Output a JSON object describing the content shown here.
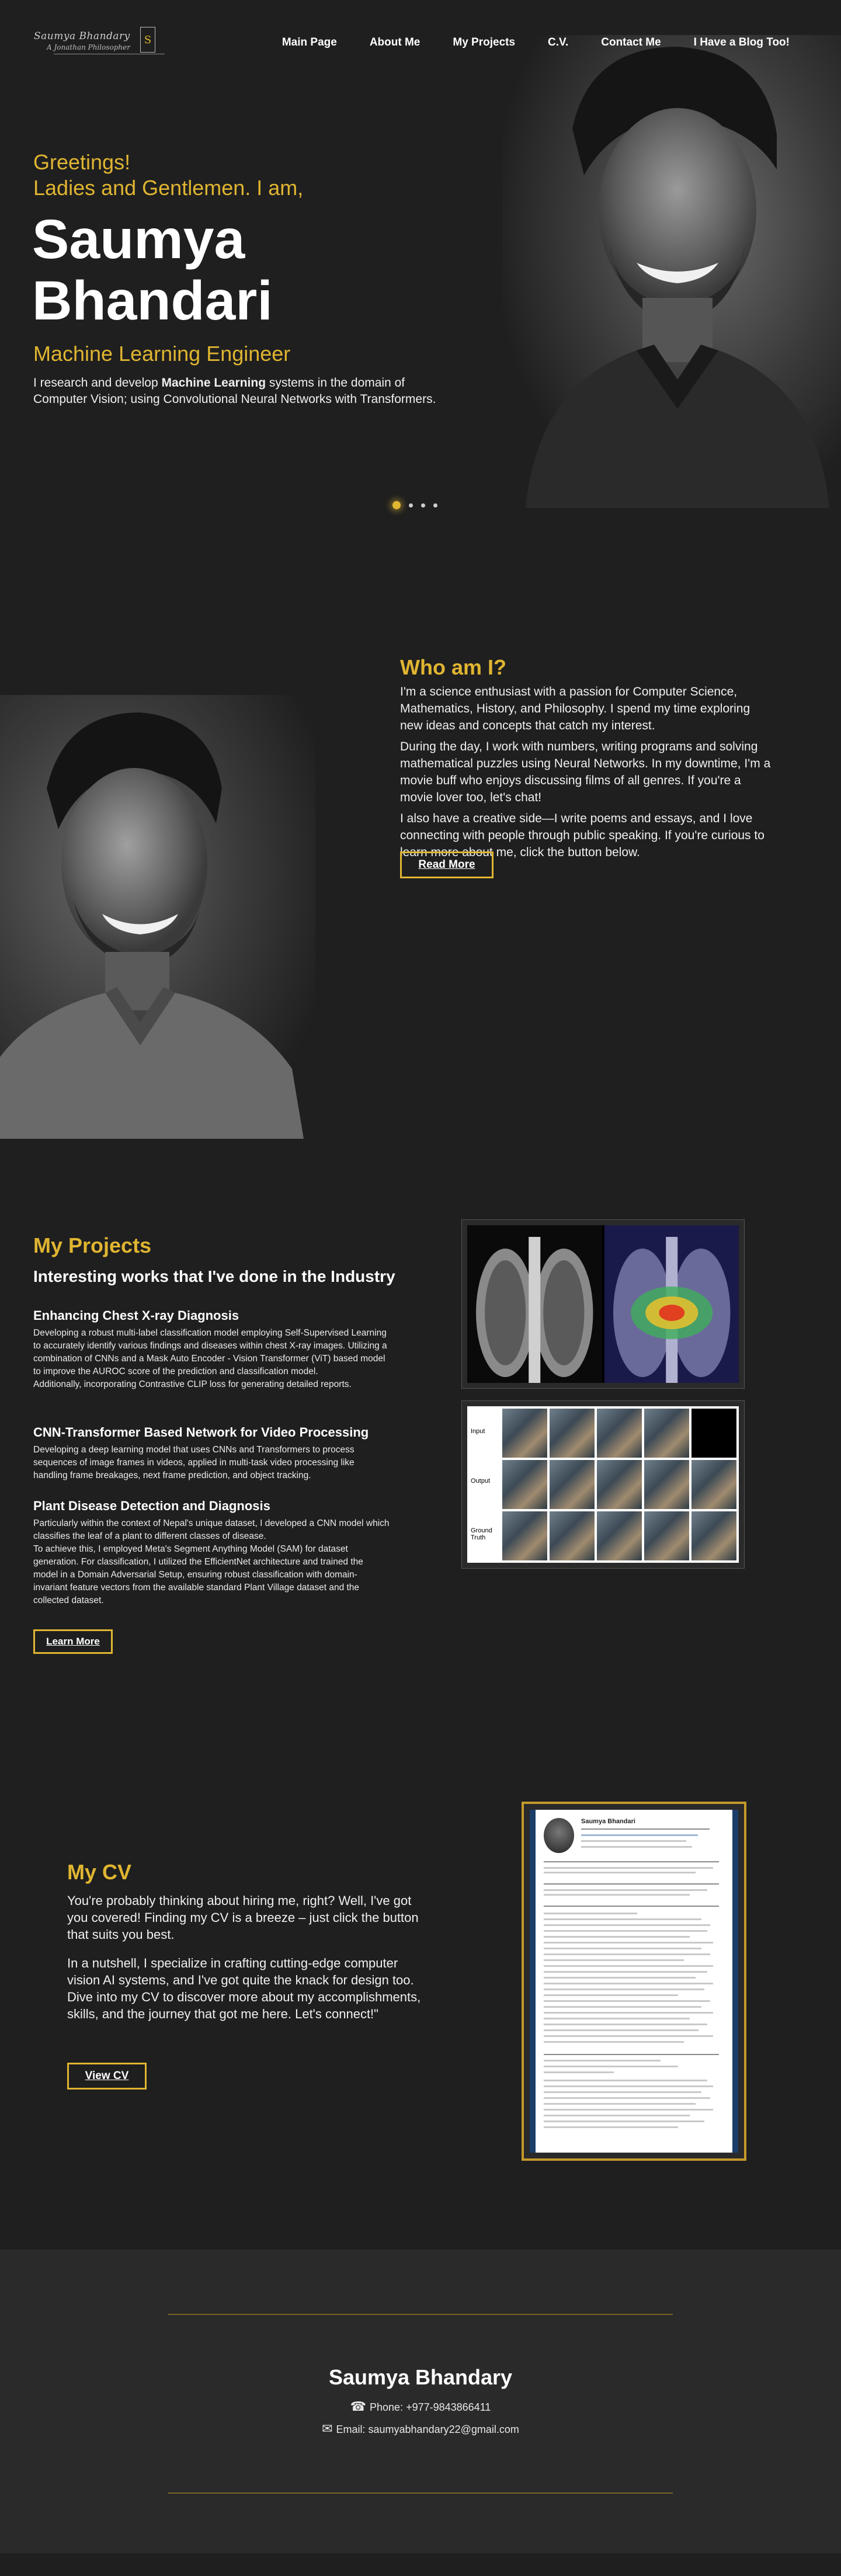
{
  "logo": {
    "name": "Saumya Bhandary",
    "tagline": "A Jonathan Philosopher",
    "mark": "S"
  },
  "nav": {
    "items": [
      "Main Page",
      "About Me",
      "My Projects",
      "C.V.",
      "Contact Me",
      "I Have a Blog Too!"
    ]
  },
  "hero": {
    "greeting_line1": "Greetings!",
    "greeting_line2": "Ladies and Gentlemen. I am,",
    "name_line1": "Saumya",
    "name_line2": "Bhandari",
    "role": "Machine Learning Engineer",
    "desc_before": "I research and develop ",
    "desc_bold": "Machine Learning",
    "desc_after": " systems in the domain of Computer Vision; using Convolutional Neural Networks with Transformers."
  },
  "about": {
    "title": "Who am I?",
    "p1": "I'm a science enthusiast with a passion for Computer Science, Mathematics, History, and Philosophy. I spend my time exploring new ideas and concepts that catch my interest.",
    "p2": "During the day, I work with numbers, writing programs and solving mathematical puzzles using Neural Networks. In my downtime, I'm a movie buff who enjoys discussing films of all genres. If you're a movie lover too, let's chat!",
    "p3": "I also have a creative side—I write poems and essays, and I love connecting with people through public speaking. If you're curious to learn more about me, click the button below.",
    "button": "Read More"
  },
  "projects": {
    "title": "My Projects",
    "subtitle": "Interesting works that I've done in the Industry",
    "items": [
      {
        "title": "Enhancing Chest X-ray Diagnosis",
        "desc": "Developing a robust multi-label classification model employing Self-Supervised Learning to accurately identify various findings and diseases within chest X-ray images. Utilizing a combination of CNNs and a Mask Auto Encoder - Vision Transformer (ViT) based model to improve the AUROC score of the prediction and classification model.",
        "desc2": "Additionally, incorporating Contrastive CLIP loss for generating detailed reports."
      },
      {
        "title": "CNN-Transformer Based Network for Video Processing",
        "desc": "Developing a deep learning model that uses CNNs and Transformers to process sequences of image frames in videos, applied in multi-task video processing like handling frame breakages, next frame prediction, and object tracking.",
        "desc2": ""
      },
      {
        "title": "Plant Disease Detection and Diagnosis",
        "desc": "Particularly within the context of Nepal's unique dataset, I developed a CNN model which classifies the leaf of a plant to different classes of disease.",
        "desc2": "To achieve this, I employed Meta's Segment Anything Model (SAM) for dataset generation. For classification, I utilized the EfficientNet architecture and trained the model in a Domain Adversarial Setup, ensuring robust classification with domain-invariant feature vectors from the available standard Plant Village dataset and the collected dataset."
      }
    ],
    "button": "Learn More",
    "grid_labels": [
      "Input",
      "Output",
      "Ground Truth"
    ]
  },
  "cv": {
    "title": "My CV",
    "p1": "You're probably thinking about hiring me, right? Well, I've got you covered! Finding my CV is a breeze – just click the button that suits you best.",
    "p2": "In a nutshell, I specialize in crafting cutting-edge computer vision AI systems, and I've got quite the knack for design too. Dive into my CV to discover more about my accomplishments, skills, and the journey that got me here. Let's connect!\"",
    "button": "View CV",
    "doc_name": "Saumya Bhandari"
  },
  "footer": {
    "name": "Saumya Bhandary",
    "phone": "Phone: +977-9843866411",
    "email": "Email: saumyabhandary22@gmail.com"
  },
  "colors": {
    "accent": "#e0b531",
    "background": "#1f1f1f",
    "footer_bg": "#2a2a2a"
  }
}
